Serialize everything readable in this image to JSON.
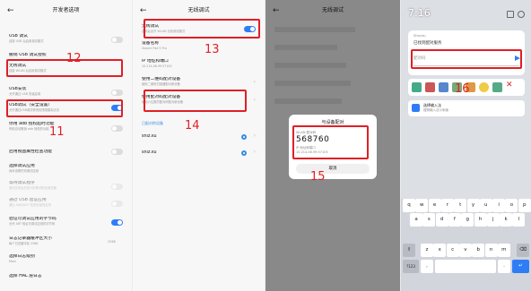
{
  "panel1": {
    "title": "开发者选项",
    "items": [
      {
        "title": "USB 调试",
        "sub": "连接 USB 后启用调试模式"
      },
      {
        "title": "撤销 USB 调试授权"
      },
      {
        "title": "无线调试",
        "sub": "连接 WLAN 后启用调试模式"
      },
      {
        "title": "USB安装",
        "sub": "允许通过 USB 安装应用"
      },
      {
        "title": "USB调试（安全设置）",
        "sub": "允许通过USB调试修改权限或模拟点击"
      },
      {
        "title": "停用 adb 授权超时功能",
        "sub": "停用自动撤销 adb 授权的功能"
      },
      {
        "title": "启用视图属性检查功能"
      },
      {
        "title": "选择调试应用",
        "sub": "尚未设置任何调试应用"
      },
      {
        "title": "等待调试程序",
        "sub": "调试应用会在执行前等待附加调试器"
      },
      {
        "title": "通过 USB 验证应用",
        "sub": "通过 ADB/ADT 检查安装的应用"
      },
      {
        "title": "验证可调试应用的字节码",
        "sub": "允许 ART 验证可调试应用的字节码"
      },
      {
        "title": "日志记录器缓冲区大小",
        "sub": "每个日志缓冲区 256K",
        "value": "256K"
      },
      {
        "title": "选择日志级别",
        "sub": "Main"
      },
      {
        "title": "选择 HAL 层日志"
      }
    ],
    "section_label": "调试",
    "marker_12": "12",
    "marker_11": "11"
  },
  "panel2": {
    "title": "无线调试",
    "items": [
      {
        "title": "无线调试",
        "sub": "启用后允许 WLAN 无线调试模式"
      },
      {
        "title": "设备名称",
        "sub": "Xiaomi Pad 5 Pro"
      },
      {
        "title": "IP 地址和端口",
        "sub": "10.214.46.99:37105"
      },
      {
        "title": "使用二维码配对设备",
        "sub": "使用二维码扫描器配对新设备"
      },
      {
        "title": "使用配对码配对设备",
        "sub": "使用六位数的配对码配对新设备"
      }
    ],
    "paired_label": "已配对的设备",
    "devices": [
      "shiz.ku",
      "shiz.ku"
    ],
    "marker_13": "13",
    "marker_14": "14"
  },
  "panel3": {
    "title": "无线调试",
    "dialog_title": "与设备配对",
    "wlan_label": "WLAN 配对码",
    "code": "568760",
    "ip_label": "IP 地址和端口",
    "ip": "10.214.46.99:37105",
    "cancel": "取消",
    "marker_15": "15"
  },
  "panel4": {
    "time": "7:16",
    "app_name": "Shizuku",
    "notif_title": "已找到配对服务",
    "input_placeholder": "配对码",
    "ime_title": "选择输入法",
    "ime_sub": "搜狗输入法小米版",
    "marker_16": "16",
    "keys_row1": [
      "q",
      "w",
      "e",
      "r",
      "t",
      "y",
      "u",
      "i",
      "o",
      "p"
    ],
    "keys_row2": [
      "a",
      "s",
      "d",
      "f",
      "g",
      "h",
      "j",
      "k",
      "l"
    ],
    "keys_row3": [
      "z",
      "x",
      "c",
      "v",
      "b",
      "n",
      "m"
    ],
    "key_sym": "?123",
    "key_comma": ",",
    "key_period": "."
  },
  "colors": {
    "red": "#e01f26",
    "blue": "#2f7df6"
  }
}
